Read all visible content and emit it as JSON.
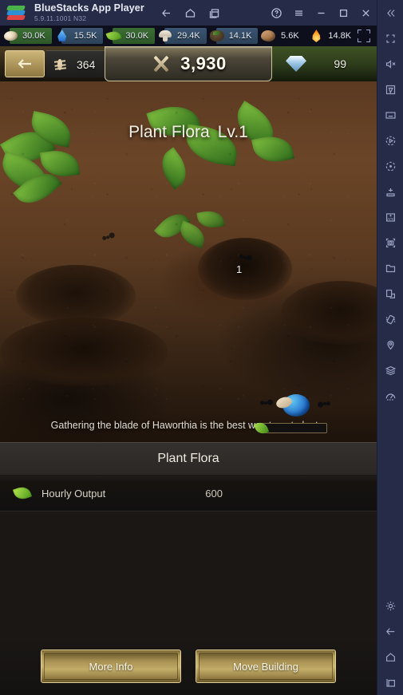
{
  "titlebar": {
    "app_name": "BlueStacks App Player",
    "version": "5.9.11.1001  N32",
    "logo_icon": "bluestacks-logo",
    "nav_icons": [
      "back-icon",
      "home-icon",
      "multi-instance-icon"
    ],
    "window_icons": [
      "help-icon",
      "menu-icon",
      "minimize-icon",
      "maximize-icon",
      "close-icon",
      "collapse-icon"
    ]
  },
  "resourcebar": {
    "fullscreen_icon": "fullscreen-icon",
    "items": [
      {
        "icon": "larva-icon",
        "value": "30.0K",
        "style": "g"
      },
      {
        "icon": "water-icon",
        "value": "15.5K",
        "style": "b"
      },
      {
        "icon": "leaf-icon",
        "value": "30.0K",
        "style": "g"
      },
      {
        "icon": "mushroom-icon",
        "value": "29.4K",
        "style": "b"
      },
      {
        "icon": "soil-icon",
        "value": "14.1K",
        "style": "b"
      },
      {
        "icon": "nut-icon",
        "value": "5.6K",
        "style": "n"
      },
      {
        "icon": "honey-icon",
        "value": "14.8K",
        "style": "n"
      }
    ]
  },
  "hud": {
    "back_icon": "back-arrow-icon",
    "ant_icon": "ant-icon",
    "ant_count": "364",
    "power_icon": "crossed-swords-icon",
    "power_value": "3,930",
    "gem_icon": "diamond-icon",
    "gem_count": "99"
  },
  "scene": {
    "building_title": "Plant Flora",
    "building_level": "Lv.1",
    "pit_count": "1",
    "description": "Gathering the blade of Haworthia is the best way to get plants.",
    "critter_icon": "blue-beetle-icon",
    "progress_leaf_icon": "leaf-icon",
    "progress_percent": 0
  },
  "panel": {
    "name": "Plant Flora",
    "stats": [
      {
        "icon": "leaf-icon",
        "label": "Hourly Output",
        "value": "600"
      }
    ]
  },
  "footer": {
    "more_info_label": "More Info",
    "move_building_label": "Move Building"
  },
  "sidebar": {
    "top_icons": [
      "collapse-icon",
      "fullscreen-icon",
      "mute-icon",
      "pointer-icon",
      "keyboard-icon",
      "macro-record-icon",
      "record-screen-icon",
      "game-controls-icon",
      "install-apk-icon",
      "screenshot-icon",
      "media-manager-icon",
      "copy-to-pc-icon",
      "shake-icon",
      "location-icon",
      "multi-instance-sync-icon",
      "performance-icon"
    ],
    "bottom_icons": [
      "settings-icon",
      "back-icon",
      "home-icon",
      "recents-icon"
    ]
  },
  "colors": {
    "titlebar_bg": "#262b47",
    "resource_green": "#3b6e34",
    "resource_blue": "#3a5572",
    "gold_button": "#cdb671",
    "panel_bg": "#201d1a"
  }
}
